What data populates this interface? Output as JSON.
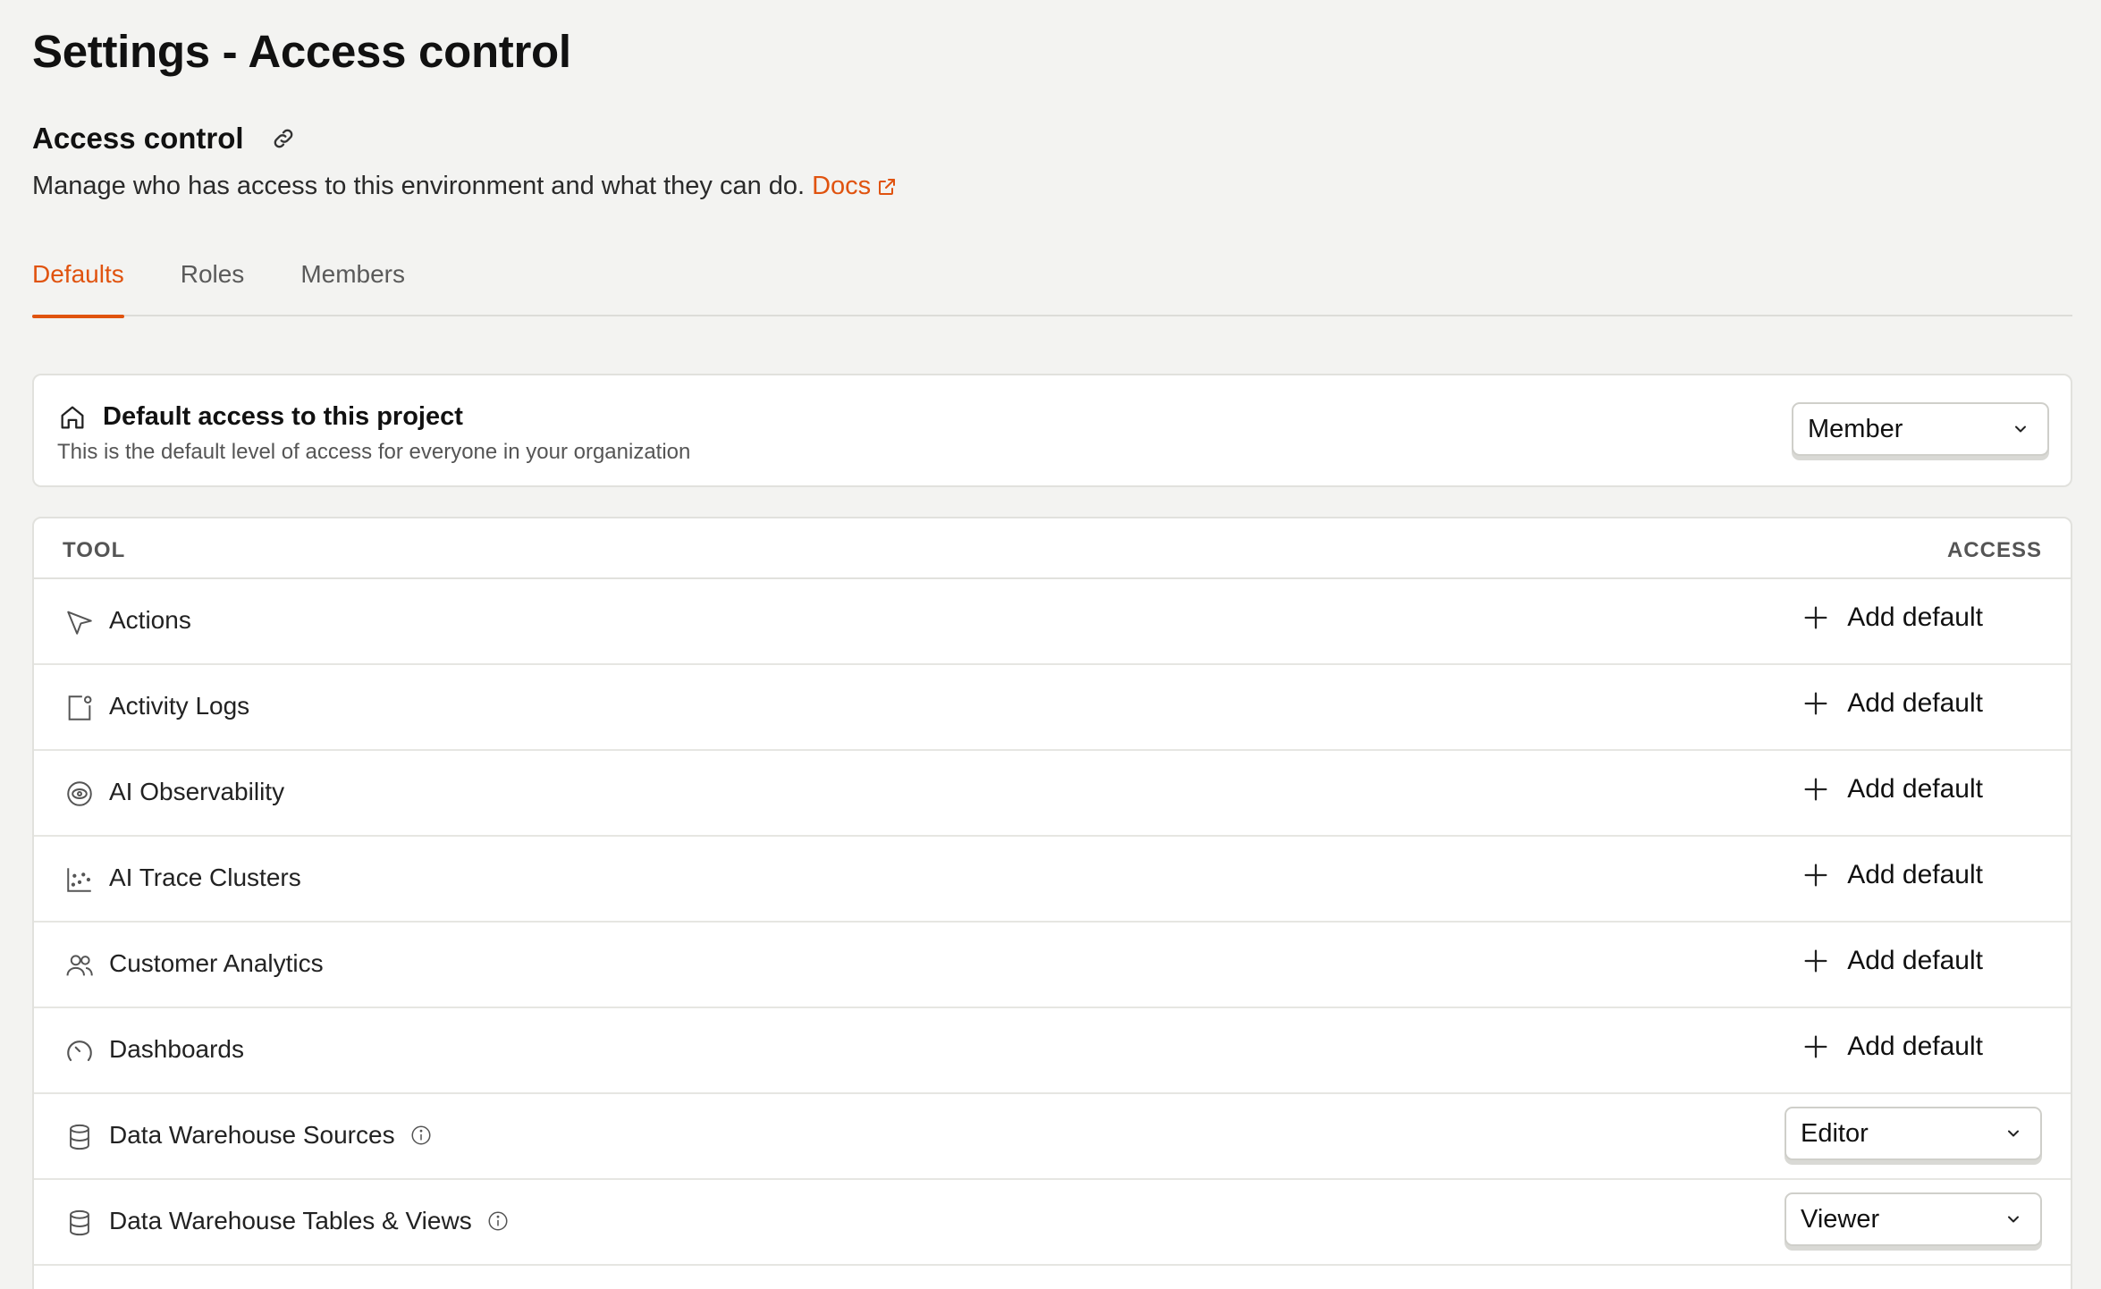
{
  "page": {
    "title": "Settings - Access control"
  },
  "section": {
    "title": "Access control",
    "description": "Manage who has access to this environment and what they can do.",
    "docs_label": "Docs"
  },
  "tabs": [
    {
      "label": "Defaults",
      "active": true
    },
    {
      "label": "Roles",
      "active": false
    },
    {
      "label": "Members",
      "active": false
    }
  ],
  "default_access": {
    "title": "Default access to this project",
    "subtitle": "This is the default level of access for everyone in your organization",
    "selected": "Member"
  },
  "table": {
    "col_tool": "TOOL",
    "col_access": "ACCESS",
    "add_label": "Add default",
    "rows": [
      {
        "name": "Actions",
        "icon": "cursor-arrow-icon",
        "access": null
      },
      {
        "name": "Activity Logs",
        "icon": "activity-log-icon",
        "access": null
      },
      {
        "name": "AI Observability",
        "icon": "eye-radar-icon",
        "access": null
      },
      {
        "name": "AI Trace Clusters",
        "icon": "scatter-plot-icon",
        "access": null
      },
      {
        "name": "Customer Analytics",
        "icon": "users-icon",
        "access": null
      },
      {
        "name": "Dashboards",
        "icon": "gauge-icon",
        "access": null
      },
      {
        "name": "Data Warehouse Sources",
        "icon": "database-icon",
        "access": "Editor",
        "info": true
      },
      {
        "name": "Data Warehouse Tables & Views",
        "icon": "database-icon",
        "access": "Viewer",
        "info": true
      }
    ]
  },
  "colors": {
    "accent": "#e0530f",
    "background": "#f3f3f1",
    "card": "#ffffff"
  }
}
